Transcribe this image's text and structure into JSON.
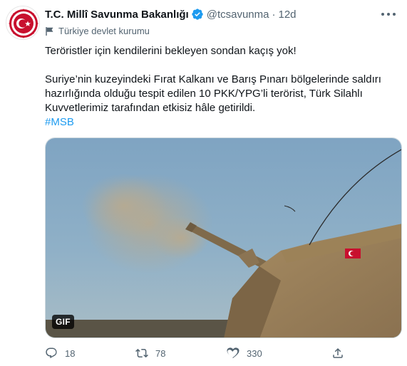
{
  "tweet": {
    "display_name": "T.C. Millî Savunma Bakanlığı",
    "handle": "@tcsavunma",
    "separator": "·",
    "time": "12d",
    "account_label": "Türkiye devlet kurumu",
    "text_lines": [
      "Teröristler için kendilerini bekleyen sondan kaçış yok!",
      "Suriye’nin kuzeyindeki Fırat Kalkanı ve Barış Pınarı bölgelerinde saldırı",
      "hazırlığında olduğu tespit edilen 10 PKK/YPG’li terörist, Türk Silahlı",
      "Kuvvetlerimiz tarafından etkisiz hâle getirildi."
    ],
    "hashtag": "#MSB",
    "media_badge": "GIF",
    "counts": {
      "replies": "18",
      "retweets": "78",
      "likes": "330"
    }
  },
  "icons": {
    "verified": "verified-badge-icon",
    "more": "more-options-icon",
    "label": "government-flag-icon",
    "reply": "reply-icon",
    "retweet": "retweet-icon",
    "like": "like-heart-icon",
    "share": "share-icon"
  },
  "colors": {
    "accent": "#1d9bf0",
    "text": "#0f1419",
    "secondary": "#536471",
    "avatar_red": "#c8102e"
  }
}
